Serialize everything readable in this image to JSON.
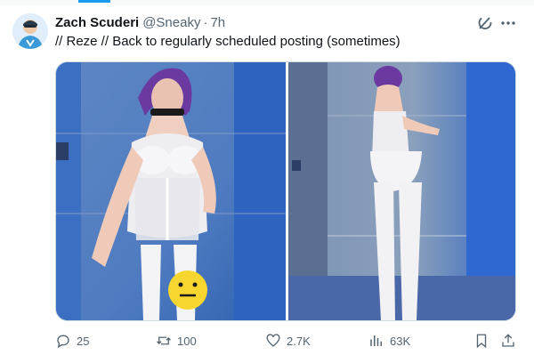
{
  "tweet": {
    "author_name": "Zach Scuderi",
    "handle": "@Sneaky",
    "separator": "·",
    "time": "7h",
    "text": "// Reze // Back to regularly scheduled posting (sometimes)"
  },
  "media": {
    "count": 2,
    "accent_colors": {
      "wall_blue": "#3a74c8",
      "tile_grey": "#8aa0bc",
      "outfit_white": "#f2f2f4",
      "hair_purple": "#6a3aa0",
      "emoji_yellow": "#f7d630"
    }
  },
  "actions": {
    "replies": "25",
    "reposts": "100",
    "likes": "2.7K",
    "views": "63K"
  },
  "icons": [
    "grok-icon",
    "more-icon",
    "reply-icon",
    "repost-icon",
    "like-icon",
    "views-icon",
    "bookmark-icon",
    "share-icon"
  ],
  "colors": {
    "text_primary": "#0f1419",
    "text_secondary": "#536471",
    "accent": "#1d9bf0"
  }
}
